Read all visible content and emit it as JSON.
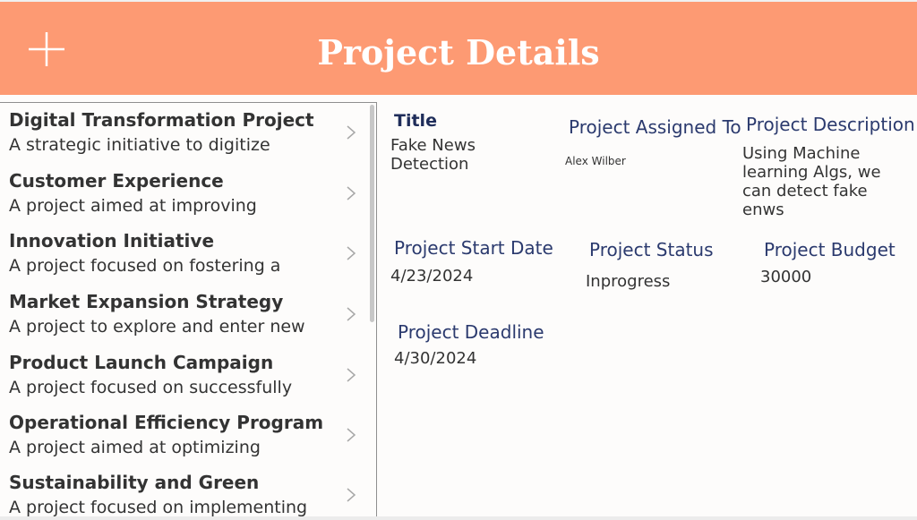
{
  "header": {
    "title": "Project Details",
    "bg_color": "#fd9a73",
    "add_icon": "plus-icon"
  },
  "gallery": {
    "items": [
      {
        "title": "Digital Transformation Project",
        "subtitle": "A strategic initiative to digitize"
      },
      {
        "title": "Customer Experience",
        "subtitle": "A project aimed at improving"
      },
      {
        "title": "Innovation Initiative",
        "subtitle": "A project focused on fostering a"
      },
      {
        "title": "Market Expansion Strategy",
        "subtitle": "A project to explore and enter new"
      },
      {
        "title": "Product Launch Campaign",
        "subtitle": "A project focused on successfully"
      },
      {
        "title": "Operational Efficiency Program",
        "subtitle": "A project aimed at optimizing"
      },
      {
        "title": "Sustainability and Green",
        "subtitle": "A project focused on implementing"
      }
    ],
    "chevron_icon": "chevron-right-icon"
  },
  "details": {
    "title": {
      "label": "Title",
      "value": "Fake News Detection"
    },
    "assigned_to": {
      "label": "Project Assigned To",
      "value": "Alex Wilber"
    },
    "description": {
      "label": "Project Description",
      "value": "Using Machine learning Algs, we can detect fake enws"
    },
    "start_date": {
      "label": "Project Start Date",
      "value": "4/23/2024"
    },
    "status": {
      "label": "Project Status",
      "value": "Inprogress"
    },
    "budget": {
      "label": "Project Budget",
      "value": "30000"
    },
    "deadline": {
      "label": "Project Deadline",
      "value": "4/30/2024"
    }
  }
}
